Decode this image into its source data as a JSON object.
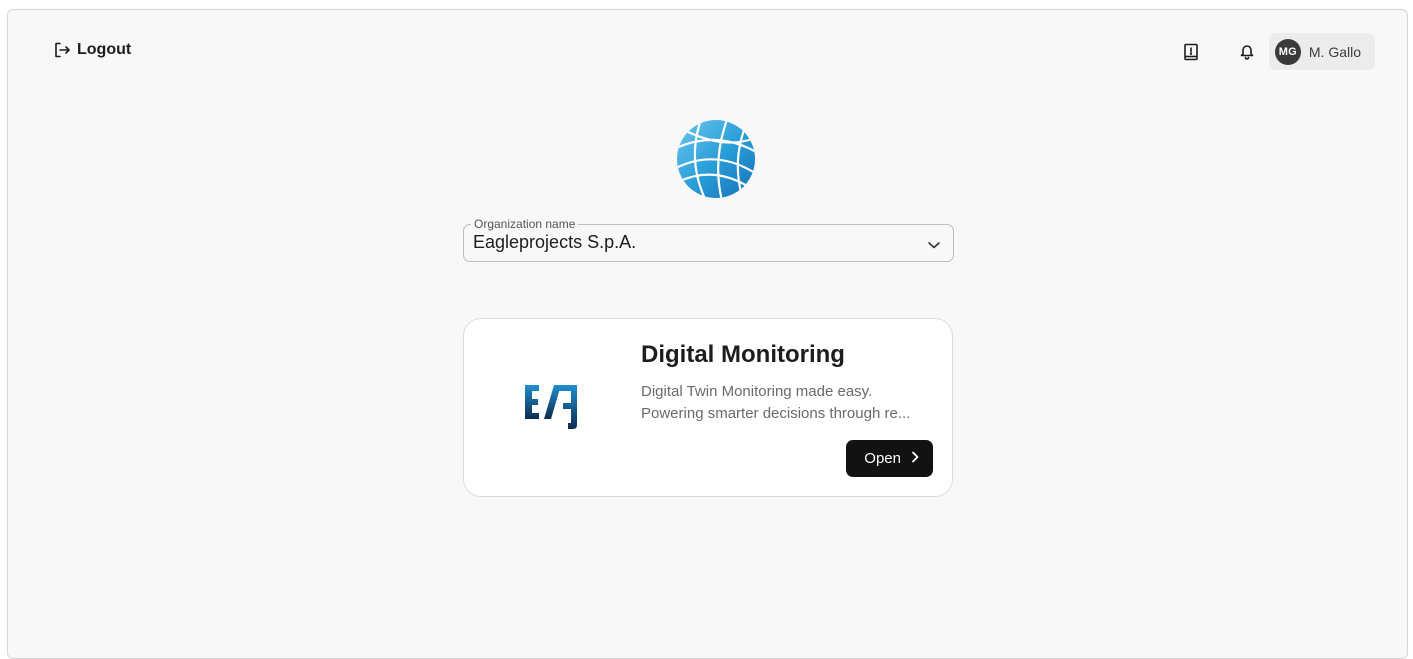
{
  "header": {
    "logout_label": "Logout",
    "user": {
      "initials": "MG",
      "name": "M. Gallo"
    },
    "icons": {
      "logout": "logout-icon",
      "book": "book-icon",
      "bell": "bell-icon"
    }
  },
  "org_select": {
    "label": "Organization name",
    "value": "Eagleprojects S.p.A."
  },
  "app_card": {
    "title": "Digital Monitoring",
    "description_line1": "Digital Twin Monitoring made easy.",
    "description_line2": "Powering smarter decisions through re...",
    "open_label": "Open",
    "logo_text": "E/A"
  },
  "colors": {
    "accent_blue": "#1e90d0",
    "logo_navy": "#0d2c4f",
    "button_dark": "#121212"
  }
}
